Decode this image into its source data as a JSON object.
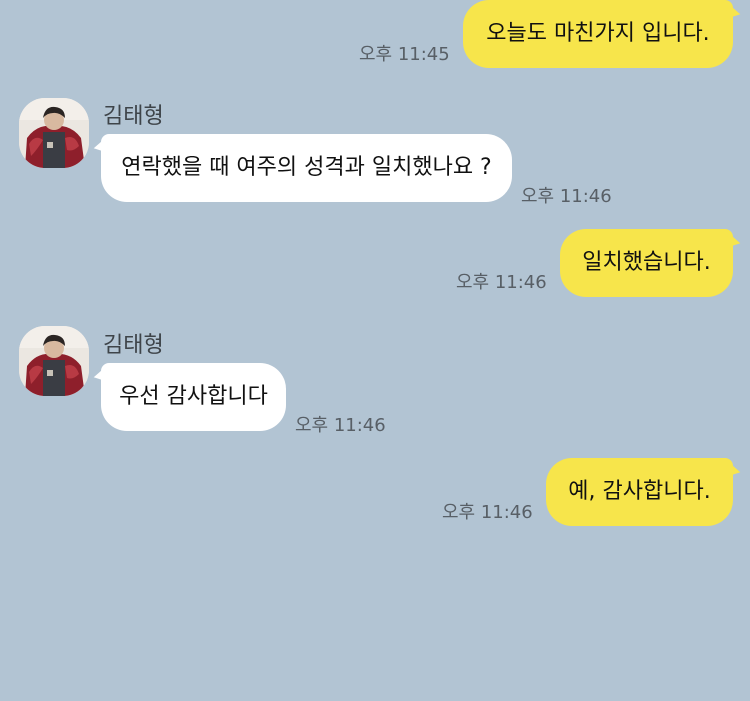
{
  "colors": {
    "background": "#b2c4d3",
    "my_bubble": "#f7e54b",
    "their_bubble": "#ffffff",
    "timestamp": "#585f66"
  },
  "messages": [
    {
      "id": 0,
      "direction": "outgoing",
      "text": "오늘도 마친가지 입니다.",
      "time": "오후 11:45"
    },
    {
      "id": 1,
      "direction": "incoming",
      "sender": "김태형",
      "avatar": "profile-avatar",
      "text": "연락했을 때 여주의 성격과 일치했나요 ?",
      "time": "오후 11:46"
    },
    {
      "id": 2,
      "direction": "outgoing",
      "text": "일치했습니다.",
      "time": "오후 11:46"
    },
    {
      "id": 3,
      "direction": "incoming",
      "sender": "김태형",
      "avatar": "profile-avatar",
      "text": "우선 감사합니다",
      "time": "오후 11:46"
    },
    {
      "id": 4,
      "direction": "outgoing",
      "text": "예, 감사합니다.",
      "time": "오후 11:46"
    }
  ]
}
